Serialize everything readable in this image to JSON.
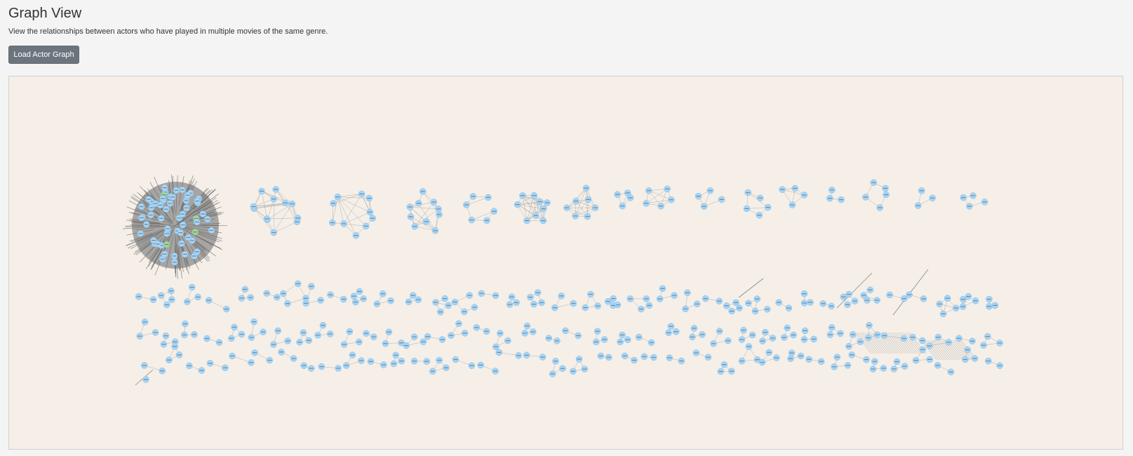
{
  "header": {
    "title": "Graph View",
    "subtitle": "View the relationships between actors who have played in multiple movies of the same genre."
  },
  "actions": {
    "load_button_label": "Load Actor Graph"
  },
  "graph": {
    "node_color": "#a6d5f7",
    "node_stroke": "#7fb9e6",
    "edge_color": "#6b6b6b",
    "hub_color": "#8c8c8c",
    "highlight_color": "#9fd98b",
    "background": "#f5efe8"
  }
}
